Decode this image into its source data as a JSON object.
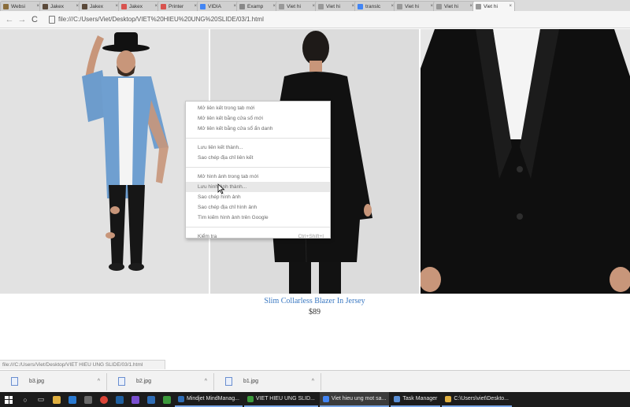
{
  "tabs": [
    {
      "label": "Websi",
      "color": "#8a6d3b"
    },
    {
      "label": "Jakex",
      "color": "#5b4a3a"
    },
    {
      "label": "Jakex",
      "color": "#5b4a3a"
    },
    {
      "label": "Jakex",
      "color": "#d9534f"
    },
    {
      "label": "Printer",
      "color": "#d9534f"
    },
    {
      "label": "VIDIA",
      "color": "#4285f4"
    },
    {
      "label": "Examp",
      "color": "#888888"
    },
    {
      "label": "Viet hi",
      "color": "#999999"
    },
    {
      "label": "Viet hi",
      "color": "#999999"
    },
    {
      "label": "translc",
      "color": "#4285f4"
    },
    {
      "label": "Viet hi",
      "color": "#999999"
    },
    {
      "label": "Viet hi",
      "color": "#999999"
    },
    {
      "label": "Viet hi",
      "color": "#999999"
    }
  ],
  "tab_close_glyph": "×",
  "toolbar": {
    "back": "←",
    "forward": "→",
    "reload": "C",
    "url": "file:///C:/Users/Viet/Desktop/VIET%20HIEU%20UNG%20SLIDE/03/1.html"
  },
  "product": {
    "name": "Slim Collarless Blazer In Jersey",
    "price": "$89"
  },
  "context_menu": {
    "groups": [
      [
        "Mở liên kết trong tab mới",
        "Mở liên kết bằng cửa sổ mới",
        "Mở liên kết bằng cửa sổ ẩn danh"
      ],
      [
        "Lưu liên kết thành...",
        "Sao chép địa chỉ liên kết"
      ],
      [
        "Mở hình ảnh trong tab mới",
        "Lưu hình ảnh thành...",
        "Sao chép hình ảnh",
        "Sao chép địa chỉ hình ảnh",
        "Tìm kiếm hình ảnh trên Google"
      ]
    ],
    "inspect": "Kiểm tra",
    "inspect_shortcut": "Ctrl+Shift+I"
  },
  "status_bar": "file:///C:/Users/Viet/Desktop/VIET HIEU UNG SLIDE/03/1.html",
  "downloads": [
    {
      "name": "b3.jpg",
      "arrow": "^"
    },
    {
      "name": "b2.jpg",
      "arrow": "^"
    },
    {
      "name": "b1.jpg",
      "arrow": "^"
    }
  ],
  "taskbar": {
    "apps": [
      {
        "label": "Mindjet MindManag...",
        "color": "#2f6db5"
      },
      {
        "label": "VIET HIEU UNG SLID...",
        "color": "#3c9a3c"
      },
      {
        "label": "Viet hieu ung mot sa...",
        "color": "#4285f4"
      },
      {
        "label": "Task Manager",
        "color": "#5a8fd6"
      },
      {
        "label": "C:\\Users\\viet\\Deskto...",
        "color": "#e0b040"
      }
    ]
  }
}
